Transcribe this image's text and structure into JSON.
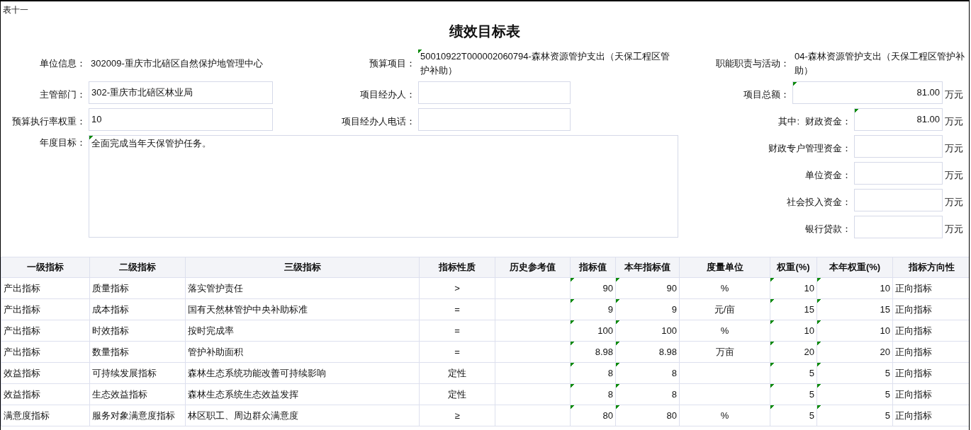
{
  "sheet_label": "表十一",
  "title": "绩效目标表",
  "unit_info": {
    "label": "单位信息：",
    "value": "302009-重庆市北碚区自然保护地管理中心"
  },
  "budget_project": {
    "label": "预算项目：",
    "value": "50010922T000002060794-森林资源管护支出（天保工程区管护补助）",
    "marked": true
  },
  "function_activity": {
    "label": "职能职责与活动：",
    "value": "04-森林资源管护支出（天保工程区管护补助）"
  },
  "department": {
    "label": "主管部门：",
    "value": "302-重庆市北碚区林业局"
  },
  "manager": {
    "label": "项目经办人："
  },
  "project_total": {
    "label": "项目总额：",
    "value": "81.00",
    "unit": "万元",
    "marked": true
  },
  "exec_weight": {
    "label": "预算执行率权重：",
    "value": "10"
  },
  "manager_phone": {
    "label": "项目经办人电话："
  },
  "of_which": "其中:",
  "funding": [
    {
      "label": "财政资金：",
      "value": "81.00",
      "unit": "万元",
      "marked": true
    },
    {
      "label": "财政专户管理资金：",
      "unit": "万元",
      "marked": false
    },
    {
      "label": "单位资金：",
      "unit": "万元",
      "marked": false
    },
    {
      "label": "社会投入资金：",
      "unit": "万元",
      "marked": false
    },
    {
      "label": "银行贷款：",
      "unit": "万元",
      "marked": false
    }
  ],
  "annual_goal": {
    "label": "年度目标：",
    "value": "全面完成当年天保管护任务。",
    "marked": true
  },
  "table": {
    "columns": [
      {
        "label": "一级指标",
        "marked": false
      },
      {
        "label": "二级指标",
        "marked": false
      },
      {
        "label": "三级指标",
        "marked": false
      },
      {
        "label": "指标性质",
        "marked": false
      },
      {
        "label": "历史参考值",
        "marked": false
      },
      {
        "label": "指标值",
        "marked": true
      },
      {
        "label": "本年指标值",
        "marked": true
      },
      {
        "label": "度量单位",
        "marked": false
      },
      {
        "label": "权重(%)",
        "marked": true
      },
      {
        "label": "本年权重(%)",
        "marked": true
      },
      {
        "label": "指标方向性",
        "marked": false
      }
    ],
    "rows": [
      [
        "产出指标",
        "质量指标",
        "落实管护责任",
        ">",
        "",
        "90",
        "90",
        "%",
        "10",
        "10",
        "正向指标"
      ],
      [
        "产出指标",
        "成本指标",
        "国有天然林管护中央补助标准",
        "=",
        "",
        "9",
        "9",
        "元/亩",
        "15",
        "15",
        "正向指标"
      ],
      [
        "产出指标",
        "时效指标",
        "按时完成率",
        "=",
        "",
        "100",
        "100",
        "%",
        "10",
        "10",
        "正向指标"
      ],
      [
        "产出指标",
        "数量指标",
        "管护补助面积",
        "=",
        "",
        "8.98",
        "8.98",
        "万亩",
        "20",
        "20",
        "正向指标"
      ],
      [
        "效益指标",
        "可持续发展指标",
        "森林生态系统功能改善可持续影响",
        "定性",
        "",
        "8",
        "8",
        "",
        "5",
        "5",
        "正向指标"
      ],
      [
        "效益指标",
        "生态效益指标",
        "森林生态系统生态效益发挥",
        "定性",
        "",
        "8",
        "8",
        "",
        "5",
        "5",
        "正向指标"
      ],
      [
        "满意度指标",
        "服务对象满意度指标",
        "林区职工、周边群众满意度",
        "≥",
        "",
        "80",
        "80",
        "%",
        "5",
        "5",
        "正向指标"
      ]
    ]
  }
}
